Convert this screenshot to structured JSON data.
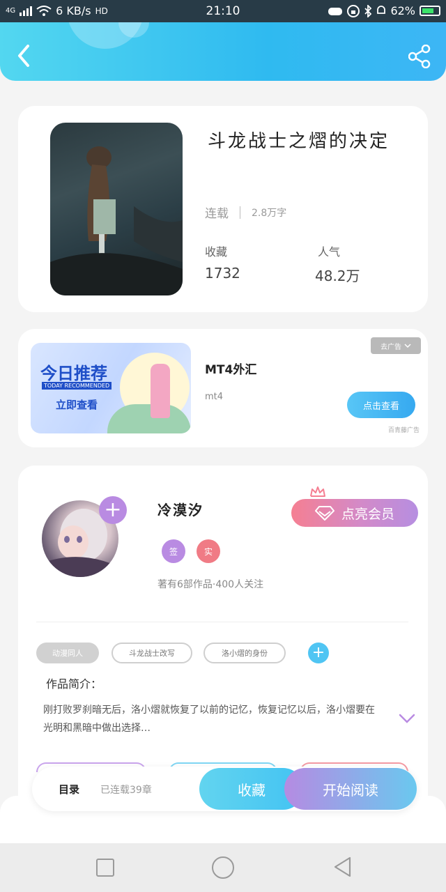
{
  "status_bar": {
    "network": "4G",
    "speed": "6 KB/s",
    "hd": "HD",
    "time": "21:10",
    "battery": "62%"
  },
  "header": {
    "back_icon": "chevron-left-icon",
    "share_icon": "share-icon",
    "accent": "#2fbaf0"
  },
  "book": {
    "title": "斗龙战士之熠的决定",
    "status": "连载",
    "word_count": "2.8万字",
    "favorites_label": "收藏",
    "favorites_value": "1732",
    "popularity_label": "人气",
    "popularity_value": "48.2万"
  },
  "ad": {
    "banner_title": "今日推荐",
    "banner_subtitle": "TODAY RECOMMENDED",
    "banner_cta": "立即查看",
    "title": "MT4外汇",
    "subtitle": "mt4",
    "close_label": "去广告",
    "button_label": "点击查看",
    "source": "百青藤广告"
  },
  "author": {
    "name": "冷漠汐",
    "badge_1": "签",
    "badge_2": "实",
    "info": "著有6部作品·400人关注",
    "vip_label": "点亮会员"
  },
  "tags": [
    "动漫同人",
    "斗龙战士改写",
    "洛小熠的身份"
  ],
  "intro": {
    "title": "作品简介：",
    "text": "刚打败罗刹暗无后，洛小熠就恢复了以前的记忆，恢复记忆以后，洛小熠要在光明和黑暗中做出选择…"
  },
  "actions": {
    "toc_label": "目录",
    "chapters": "已连载39章",
    "favorite_label": "收藏",
    "read_label": "开始阅读"
  }
}
